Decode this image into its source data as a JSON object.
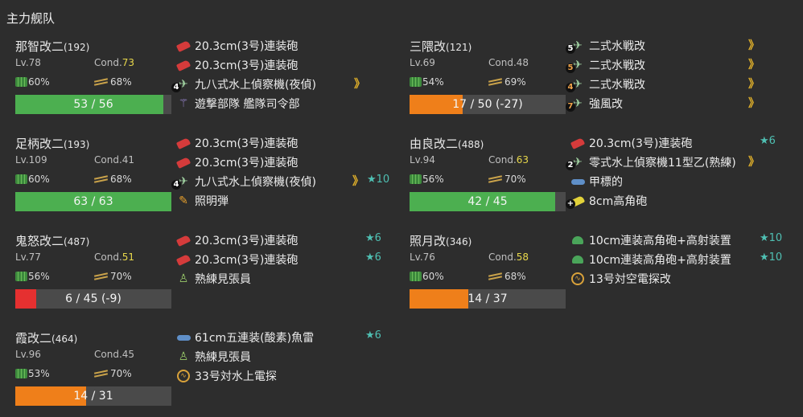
{
  "fleet": {
    "title": "主力舰队"
  },
  "colors": {
    "hp_green": "#4caf50",
    "hp_orange": "#ef7f1a",
    "hp_red": "#e53030",
    "cond_sparkle": "#e8d84b",
    "improvement_star": "#4fc0b3",
    "proficiency": "#e3b22a"
  },
  "ships": [
    {
      "name": "那智改二",
      "id": "(192)",
      "lv": "Lv.78",
      "cond_label": "Cond.",
      "cond": "73",
      "fuel": "60%",
      "ammo": "68%",
      "hp": "53 / 56",
      "hp_ratio": 0.946,
      "hp_color": "green",
      "equips": [
        {
          "icon": "main-gun-icon",
          "slot": "",
          "name": "20.3cm(3号)連装砲",
          "prof": "",
          "star": ""
        },
        {
          "icon": "main-gun-icon",
          "slot": "",
          "name": "20.3cm(3号)連装砲",
          "prof": "",
          "star": ""
        },
        {
          "icon": "seaplane-icon",
          "slot": "4",
          "name": "九八式水上偵察機(夜偵)",
          "prof": "》",
          "star": ""
        },
        {
          "icon": "fleet-command-icon",
          "slot": "",
          "name": "遊撃部隊 艦隊司令部",
          "prof": "",
          "star": ""
        }
      ]
    },
    {
      "name": "足柄改二",
      "id": "(193)",
      "lv": "Lv.109",
      "cond_label": "Cond.",
      "cond": "41",
      "fuel": "60%",
      "ammo": "68%",
      "hp": "63 / 63",
      "hp_ratio": 1.0,
      "hp_color": "green",
      "equips": [
        {
          "icon": "main-gun-icon",
          "slot": "",
          "name": "20.3cm(3号)連装砲",
          "prof": "",
          "star": ""
        },
        {
          "icon": "main-gun-icon",
          "slot": "",
          "name": "20.3cm(3号)連装砲",
          "prof": "",
          "star": ""
        },
        {
          "icon": "seaplane-icon",
          "slot": "4",
          "name": "九八式水上偵察機(夜偵)",
          "prof": "》",
          "star": "★10"
        },
        {
          "icon": "star-shell-icon",
          "slot": "",
          "name": "照明弾",
          "prof": "",
          "star": ""
        }
      ]
    },
    {
      "name": "鬼怒改二",
      "id": "(487)",
      "lv": "Lv.77",
      "cond_label": "Cond.",
      "cond": "51",
      "fuel": "56%",
      "ammo": "70%",
      "hp": "6 / 45 (-9)",
      "hp_ratio": 0.133,
      "hp_color": "red",
      "equips": [
        {
          "icon": "main-gun-icon",
          "slot": "",
          "name": "20.3cm(3号)連装砲",
          "prof": "",
          "star": "★6"
        },
        {
          "icon": "main-gun-icon",
          "slot": "",
          "name": "20.3cm(3号)連装砲",
          "prof": "",
          "star": "★6"
        },
        {
          "icon": "lookout-icon",
          "slot": "",
          "name": "熟練見張員",
          "prof": "",
          "star": ""
        }
      ]
    },
    {
      "name": "霞改二",
      "id": "(464)",
      "lv": "Lv.96",
      "cond_label": "Cond.",
      "cond": "45",
      "fuel": "53%",
      "ammo": "70%",
      "hp": "14 / 31",
      "hp_ratio": 0.452,
      "hp_color": "orange",
      "equips": [
        {
          "icon": "torpedo-icon",
          "slot": "",
          "name": "61cm五連装(酸素)魚雷",
          "prof": "",
          "star": "★6"
        },
        {
          "icon": "lookout-icon",
          "slot": "",
          "name": "熟練見張員",
          "prof": "",
          "star": ""
        },
        {
          "icon": "radar-icon",
          "slot": "",
          "name": "33号対水上電探",
          "prof": "",
          "star": ""
        }
      ]
    },
    {
      "name": "三隈改",
      "id": "(121)",
      "lv": "Lv.69",
      "cond_label": "Cond.",
      "cond": "48",
      "fuel": "54%",
      "ammo": "69%",
      "hp": "17 / 50 (-27)",
      "hp_ratio": 0.34,
      "hp_color": "orange",
      "equips": [
        {
          "icon": "seaplane-fighter-icon",
          "slot": "5",
          "name": "二式水戦改",
          "prof": "》",
          "star": ""
        },
        {
          "icon": "seaplane-fighter-icon",
          "slot": "5",
          "name": "二式水戦改",
          "prof": "》",
          "star": ""
        },
        {
          "icon": "seaplane-fighter-icon",
          "slot": "4",
          "name": "二式水戦改",
          "prof": "》",
          "star": ""
        },
        {
          "icon": "seaplane-fighter-icon",
          "slot": "7",
          "name": "強風改",
          "prof": "》",
          "star": ""
        }
      ]
    },
    {
      "name": "由良改二",
      "id": "(488)",
      "lv": "Lv.94",
      "cond_label": "Cond.",
      "cond": "63",
      "fuel": "56%",
      "ammo": "70%",
      "hp": "42 / 45",
      "hp_ratio": 0.933,
      "hp_color": "green",
      "equips": [
        {
          "icon": "main-gun-icon",
          "slot": "",
          "name": "20.3cm(3号)連装砲",
          "prof": "",
          "star": "★6"
        },
        {
          "icon": "seaplane-icon",
          "slot": "2",
          "name": "零式水上偵察機11型乙(熟練)",
          "prof": "》",
          "star": ""
        },
        {
          "icon": "midget-sub-icon",
          "slot": "",
          "name": "甲標的",
          "prof": "",
          "star": ""
        },
        {
          "icon": "secondary-gun-icon",
          "slot": "+",
          "name": "8cm高角砲",
          "prof": "",
          "star": ""
        }
      ]
    },
    {
      "name": "照月改",
      "id": "(346)",
      "lv": "Lv.76",
      "cond_label": "Cond.",
      "cond": "58",
      "fuel": "60%",
      "ammo": "68%",
      "hp": "14 / 37",
      "hp_ratio": 0.378,
      "hp_color": "orange",
      "equips": [
        {
          "icon": "aa-gun-icon",
          "slot": "",
          "name": "10cm連装高角砲+高射装置",
          "prof": "",
          "star": "★10"
        },
        {
          "icon": "aa-gun-icon",
          "slot": "",
          "name": "10cm連装高角砲+高射装置",
          "prof": "",
          "star": "★10"
        },
        {
          "icon": "radar-icon",
          "slot": "",
          "name": "13号対空電探改",
          "prof": "",
          "star": ""
        }
      ]
    }
  ]
}
